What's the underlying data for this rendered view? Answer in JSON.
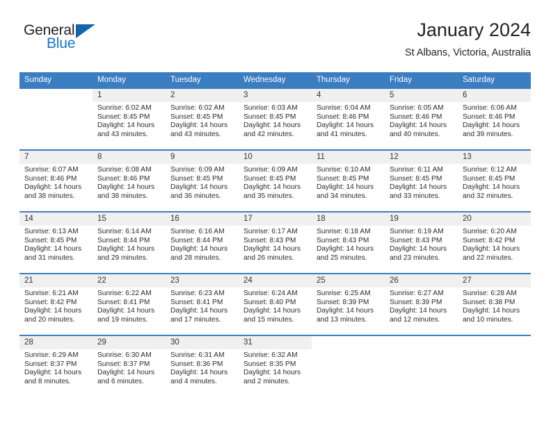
{
  "logo": {
    "word_one": "General",
    "word_two": "Blue",
    "triangle_icon": "triangle-icon",
    "color_black": "#231f20",
    "color_blue": "#1275c4",
    "color_triangle": "#1065ab"
  },
  "header": {
    "title": "January 2024",
    "subtitle": "St Albans, Victoria, Australia"
  },
  "theme": {
    "header_bg": "#3a7dc0",
    "header_text": "#ffffff",
    "daynum_bg": "#f0f0f0",
    "row_border": "#3a7dc0"
  },
  "weekdays": [
    "Sunday",
    "Monday",
    "Tuesday",
    "Wednesday",
    "Thursday",
    "Friday",
    "Saturday"
  ],
  "weeks": [
    [
      {
        "day": "",
        "sunrise": "",
        "sunset": "",
        "daylight": ""
      },
      {
        "day": "1",
        "sunrise": "Sunrise: 6:02 AM",
        "sunset": "Sunset: 8:45 PM",
        "daylight": "Daylight: 14 hours and 43 minutes."
      },
      {
        "day": "2",
        "sunrise": "Sunrise: 6:02 AM",
        "sunset": "Sunset: 8:45 PM",
        "daylight": "Daylight: 14 hours and 43 minutes."
      },
      {
        "day": "3",
        "sunrise": "Sunrise: 6:03 AM",
        "sunset": "Sunset: 8:45 PM",
        "daylight": "Daylight: 14 hours and 42 minutes."
      },
      {
        "day": "4",
        "sunrise": "Sunrise: 6:04 AM",
        "sunset": "Sunset: 8:46 PM",
        "daylight": "Daylight: 14 hours and 41 minutes."
      },
      {
        "day": "5",
        "sunrise": "Sunrise: 6:05 AM",
        "sunset": "Sunset: 8:46 PM",
        "daylight": "Daylight: 14 hours and 40 minutes."
      },
      {
        "day": "6",
        "sunrise": "Sunrise: 6:06 AM",
        "sunset": "Sunset: 8:46 PM",
        "daylight": "Daylight: 14 hours and 39 minutes."
      }
    ],
    [
      {
        "day": "7",
        "sunrise": "Sunrise: 6:07 AM",
        "sunset": "Sunset: 8:46 PM",
        "daylight": "Daylight: 14 hours and 38 minutes."
      },
      {
        "day": "8",
        "sunrise": "Sunrise: 6:08 AM",
        "sunset": "Sunset: 8:46 PM",
        "daylight": "Daylight: 14 hours and 38 minutes."
      },
      {
        "day": "9",
        "sunrise": "Sunrise: 6:09 AM",
        "sunset": "Sunset: 8:45 PM",
        "daylight": "Daylight: 14 hours and 36 minutes."
      },
      {
        "day": "10",
        "sunrise": "Sunrise: 6:09 AM",
        "sunset": "Sunset: 8:45 PM",
        "daylight": "Daylight: 14 hours and 35 minutes."
      },
      {
        "day": "11",
        "sunrise": "Sunrise: 6:10 AM",
        "sunset": "Sunset: 8:45 PM",
        "daylight": "Daylight: 14 hours and 34 minutes."
      },
      {
        "day": "12",
        "sunrise": "Sunrise: 6:11 AM",
        "sunset": "Sunset: 8:45 PM",
        "daylight": "Daylight: 14 hours and 33 minutes."
      },
      {
        "day": "13",
        "sunrise": "Sunrise: 6:12 AM",
        "sunset": "Sunset: 8:45 PM",
        "daylight": "Daylight: 14 hours and 32 minutes."
      }
    ],
    [
      {
        "day": "14",
        "sunrise": "Sunrise: 6:13 AM",
        "sunset": "Sunset: 8:45 PM",
        "daylight": "Daylight: 14 hours and 31 minutes."
      },
      {
        "day": "15",
        "sunrise": "Sunrise: 6:14 AM",
        "sunset": "Sunset: 8:44 PM",
        "daylight": "Daylight: 14 hours and 29 minutes."
      },
      {
        "day": "16",
        "sunrise": "Sunrise: 6:16 AM",
        "sunset": "Sunset: 8:44 PM",
        "daylight": "Daylight: 14 hours and 28 minutes."
      },
      {
        "day": "17",
        "sunrise": "Sunrise: 6:17 AM",
        "sunset": "Sunset: 8:43 PM",
        "daylight": "Daylight: 14 hours and 26 minutes."
      },
      {
        "day": "18",
        "sunrise": "Sunrise: 6:18 AM",
        "sunset": "Sunset: 8:43 PM",
        "daylight": "Daylight: 14 hours and 25 minutes."
      },
      {
        "day": "19",
        "sunrise": "Sunrise: 6:19 AM",
        "sunset": "Sunset: 8:43 PM",
        "daylight": "Daylight: 14 hours and 23 minutes."
      },
      {
        "day": "20",
        "sunrise": "Sunrise: 6:20 AM",
        "sunset": "Sunset: 8:42 PM",
        "daylight": "Daylight: 14 hours and 22 minutes."
      }
    ],
    [
      {
        "day": "21",
        "sunrise": "Sunrise: 6:21 AM",
        "sunset": "Sunset: 8:42 PM",
        "daylight": "Daylight: 14 hours and 20 minutes."
      },
      {
        "day": "22",
        "sunrise": "Sunrise: 6:22 AM",
        "sunset": "Sunset: 8:41 PM",
        "daylight": "Daylight: 14 hours and 19 minutes."
      },
      {
        "day": "23",
        "sunrise": "Sunrise: 6:23 AM",
        "sunset": "Sunset: 8:41 PM",
        "daylight": "Daylight: 14 hours and 17 minutes."
      },
      {
        "day": "24",
        "sunrise": "Sunrise: 6:24 AM",
        "sunset": "Sunset: 8:40 PM",
        "daylight": "Daylight: 14 hours and 15 minutes."
      },
      {
        "day": "25",
        "sunrise": "Sunrise: 6:25 AM",
        "sunset": "Sunset: 8:39 PM",
        "daylight": "Daylight: 14 hours and 13 minutes."
      },
      {
        "day": "26",
        "sunrise": "Sunrise: 6:27 AM",
        "sunset": "Sunset: 8:39 PM",
        "daylight": "Daylight: 14 hours and 12 minutes."
      },
      {
        "day": "27",
        "sunrise": "Sunrise: 6:28 AM",
        "sunset": "Sunset: 8:38 PM",
        "daylight": "Daylight: 14 hours and 10 minutes."
      }
    ],
    [
      {
        "day": "28",
        "sunrise": "Sunrise: 6:29 AM",
        "sunset": "Sunset: 8:37 PM",
        "daylight": "Daylight: 14 hours and 8 minutes."
      },
      {
        "day": "29",
        "sunrise": "Sunrise: 6:30 AM",
        "sunset": "Sunset: 8:37 PM",
        "daylight": "Daylight: 14 hours and 6 minutes."
      },
      {
        "day": "30",
        "sunrise": "Sunrise: 6:31 AM",
        "sunset": "Sunset: 8:36 PM",
        "daylight": "Daylight: 14 hours and 4 minutes."
      },
      {
        "day": "31",
        "sunrise": "Sunrise: 6:32 AM",
        "sunset": "Sunset: 8:35 PM",
        "daylight": "Daylight: 14 hours and 2 minutes."
      },
      {
        "day": "",
        "sunrise": "",
        "sunset": "",
        "daylight": ""
      },
      {
        "day": "",
        "sunrise": "",
        "sunset": "",
        "daylight": ""
      },
      {
        "day": "",
        "sunrise": "",
        "sunset": "",
        "daylight": ""
      }
    ]
  ]
}
